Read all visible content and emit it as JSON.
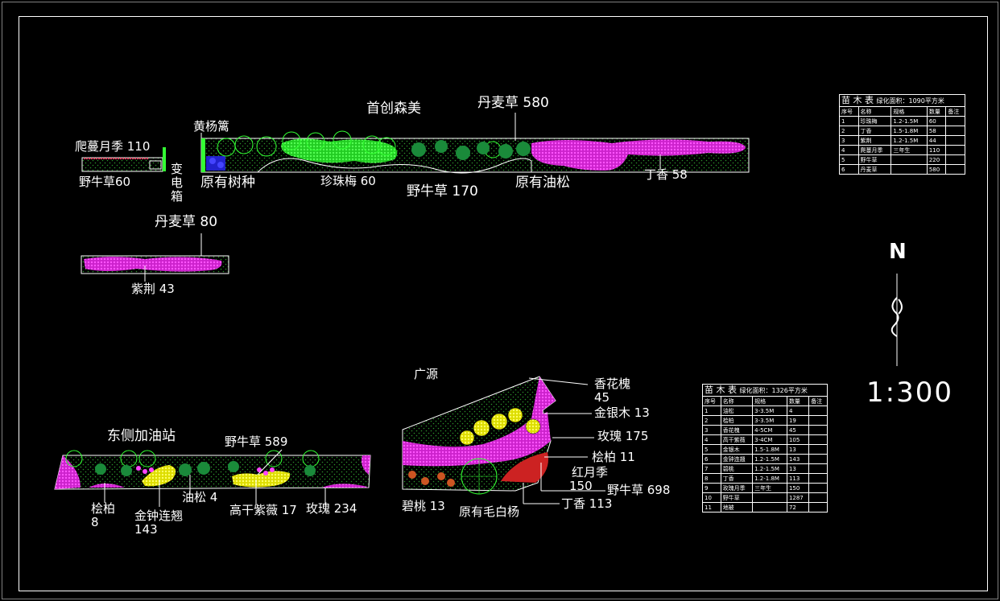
{
  "labels": {
    "shouchuang": "首创森美",
    "danmai580": "丹麦草 580",
    "huangyang": "黄杨篱",
    "pamanyueji": "爬蔓月季 110",
    "yeniucao60": "野牛草60",
    "bian": "变",
    "dian": "电",
    "xiang": "箱",
    "yuanyoushuzhong": "原有树种",
    "zhenzhumei": "珍珠梅 60",
    "yeniucao170": "野牛草 170",
    "yuanyouyousong": "原有油松",
    "dingxiang58": "丁香 58",
    "danmai80": "丹麦草 80",
    "zijing": "紫荆 43",
    "guangyuan": "广源",
    "xianghuahuai": "香花槐",
    "xianghuahuai_n": "45",
    "jinyinmu": "金银木 13",
    "meigui175": "玫瑰 175",
    "guibai11": "桧柏 11",
    "hongyueji": "红月季",
    "hongyueji_n": "150",
    "yeniucao698": "野牛草 698",
    "dingxiang113": "丁香 113",
    "yuanyoumaobaiyang": "原有毛白杨",
    "bitao": "碧桃 13",
    "dongce": "东侧加油站",
    "yeniucao589": "野牛草 589",
    "guibai8": "桧柏",
    "guibai8_n": "8",
    "jinzhonglianqiao": "金钟连翘",
    "jinzhong_n": "143",
    "yousong4": "油松 4",
    "gaogan": "高干紫薇 17",
    "meigui234": "玫瑰 234",
    "north": "N",
    "scale": "1:300"
  },
  "table1": {
    "title": "苗 木 表",
    "area": "绿化面积：1090平方米",
    "headers": [
      "序号",
      "名称",
      "规格",
      "数量",
      "备注"
    ],
    "rows": [
      [
        "1",
        "珍珠梅",
        "1.2-1.5M",
        "60",
        ""
      ],
      [
        "2",
        "丁香",
        "1.5-1.8M",
        "58",
        ""
      ],
      [
        "3",
        "紫荆",
        "1.2-1.5M",
        "44",
        ""
      ],
      [
        "4",
        "爬蔓月季",
        "三年生",
        "110",
        ""
      ],
      [
        "5",
        "野牛草",
        "",
        "220",
        ""
      ],
      [
        "6",
        "丹麦草",
        "",
        "580",
        ""
      ]
    ]
  },
  "table2": {
    "title": "苗 木 表",
    "area": "绿化面积：1326平方米",
    "headers": [
      "序号",
      "名称",
      "规格",
      "数量",
      "备注"
    ],
    "rows": [
      [
        "1",
        "油松",
        "3-3.5M",
        "4",
        ""
      ],
      [
        "2",
        "桧柏",
        "3-3.5M",
        "19",
        ""
      ],
      [
        "3",
        "香花槐",
        "4-5CM",
        "45",
        ""
      ],
      [
        "4",
        "高干紫薇",
        "3-4CM",
        "105",
        ""
      ],
      [
        "5",
        "金银木",
        "1.5-1.8M",
        "13",
        ""
      ],
      [
        "6",
        "金钟连翘",
        "1.2-1.5M",
        "143",
        ""
      ],
      [
        "7",
        "碧桃",
        "1.2-1.5M",
        "13",
        ""
      ],
      [
        "8",
        "丁香",
        "1.2-1.8M",
        "113",
        ""
      ],
      [
        "9",
        "玫瑰月季",
        "三年生",
        "150",
        ""
      ],
      [
        "10",
        "野牛草",
        "",
        "1287",
        ""
      ],
      [
        "11",
        "地被",
        "",
        "72",
        ""
      ]
    ]
  },
  "colors": {
    "magenta": "#ff33ff",
    "green": "#33ff33",
    "hatch": "#22aa22",
    "yellow": "#ffff33",
    "blue": "#3333ff",
    "red": "#ff3333"
  }
}
